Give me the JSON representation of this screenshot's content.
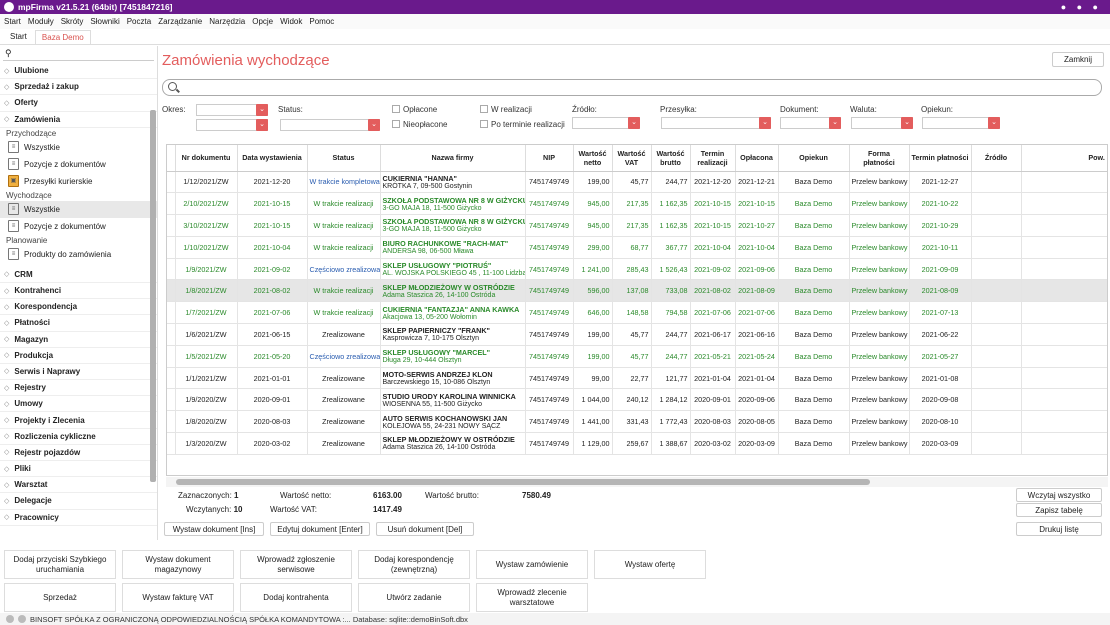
{
  "window": {
    "title": "mpFirma v21.5.21 (64bit) [7451847216]"
  },
  "menu": [
    "Start",
    "Moduły",
    "Skróty",
    "Słowniki",
    "Poczta",
    "Zarządzanie",
    "Narzędzia",
    "Opcje",
    "Widok",
    "Pomoc"
  ],
  "tabs": [
    {
      "label": "Start"
    },
    {
      "label": "Baza Demo"
    }
  ],
  "sidebar": {
    "search_placeholder": "",
    "groups_top": [
      "Ulubione",
      "Sprzedaż i zakup",
      "Oferty",
      "Zamówienia"
    ],
    "zamowienia": {
      "przychodzace": {
        "label": "Przychodzące",
        "items": [
          "Wszystkie",
          "Pozycje z dokumentów",
          "Przesyłki kurierskie"
        ]
      },
      "wychodzace": {
        "label": "Wychodzące",
        "items": [
          "Wszystkie",
          "Pozycje z dokumentów"
        ]
      },
      "planowanie": {
        "label": "Planowanie",
        "items": [
          "Produkty do zamówienia"
        ]
      }
    },
    "groups_bottom": [
      "CRM",
      "Kontrahenci",
      "Korespondencja",
      "Płatności",
      "Magazyn",
      "Produkcja",
      "Serwis i Naprawy",
      "Rejestry",
      "Umowy",
      "Projekty i Zlecenia",
      "Rozliczenia cykliczne",
      "Rejestr pojazdów",
      "Pliki",
      "Warsztat",
      "Delegacje",
      "Pracownicy"
    ]
  },
  "page": {
    "title": "Zamówienia wychodzące",
    "close_label": "Zamknij",
    "search_value": ""
  },
  "filters": {
    "okres": "Okres:",
    "status": "Status:",
    "oplacone": "Opłacone",
    "nieoplacone": "Nieopłacone",
    "w_realizacji": "W realizacji",
    "po_terminie": "Po terminie realizacji",
    "zrodlo": "Źródło:",
    "przesylka": "Przesyłka:",
    "dokument": "Dokument:",
    "waluta": "Waluta:",
    "opiekun": "Opiekun:"
  },
  "table": {
    "headers": [
      "Nr dokumentu",
      "Data wystawienia",
      "Status",
      "Nazwa firmy",
      "NIP",
      "Wartość netto",
      "Wartość VAT",
      "Wartość brutto",
      "Termin realizacji",
      "Opłacona",
      "Opiekun",
      "Forma płatności",
      "Termin płatności",
      "Źródło",
      "Pow. dok"
    ],
    "rows": [
      {
        "nr": "1/12/2021/ZW",
        "data": "2021-12-20",
        "status": "W trakcie kompletowania",
        "firma": "CUKIERNIA \"HANNA\"",
        "adres": "KRÓTKA 7, 09-500 Gostynin",
        "nip": "7451749749",
        "netto": "199,00",
        "vat": "45,77",
        "brutto": "244,77",
        "termin": "2021-12-20",
        "oplacona": "2021-12-21",
        "opiekun": "Baza Demo",
        "forma": "Przelew bankowy",
        "tplat": "2021-12-27",
        "zrodlo": "",
        "pow": "",
        "style": "normal",
        "st": "blue"
      },
      {
        "nr": "2/10/2021/ZW",
        "data": "2021-10-15",
        "status": "W trakcie realizacji",
        "firma": "SZKOŁA PODSTAWOWA NR 8 W GIŻYCKU",
        "adres": "3-GO MAJA 18, 11-500 Giżycko",
        "nip": "7451749749",
        "netto": "945,00",
        "vat": "217,35",
        "brutto": "1 162,35",
        "termin": "2021-10-15",
        "oplacona": "2021-10-15",
        "opiekun": "Baza Demo",
        "forma": "Przelew bankowy",
        "tplat": "2021-10-22",
        "zrodlo": "",
        "pow": "",
        "style": "green",
        "st": "green"
      },
      {
        "nr": "3/10/2021/ZW",
        "data": "2021-10-15",
        "status": "W trakcie realizacji",
        "firma": "SZKOŁA PODSTAWOWA NR 8 W GIŻYCKU",
        "adres": "3-GO MAJA 18, 11-500 Giżycko",
        "nip": "7451749749",
        "netto": "945,00",
        "vat": "217,35",
        "brutto": "1 162,35",
        "termin": "2021-10-15",
        "oplacona": "2021-10-27",
        "opiekun": "Baza Demo",
        "forma": "Przelew bankowy",
        "tplat": "2021-10-29",
        "zrodlo": "",
        "pow": "",
        "style": "green",
        "st": "green"
      },
      {
        "nr": "1/10/2021/ZW",
        "data": "2021-10-04",
        "status": "W trakcie realizacji",
        "firma": "BIURO RACHUNKOWE \"RACH-MAT\"",
        "adres": "ANDERSA 98, 06-500 Mława",
        "nip": "7451749749",
        "netto": "299,00",
        "vat": "68,77",
        "brutto": "367,77",
        "termin": "2021-10-04",
        "oplacona": "2021-10-04",
        "opiekun": "Baza Demo",
        "forma": "Przelew bankowy",
        "tplat": "2021-10-11",
        "zrodlo": "",
        "pow": "",
        "style": "green",
        "st": "green"
      },
      {
        "nr": "1/9/2021/ZW",
        "data": "2021-09-02",
        "status": "Częściowo zrealizowane",
        "firma": "SKLEP USŁUGOWY \"PIOTRUŚ\"",
        "adres": "AL. WOJSKA POLSKIEGO 45 , 11-100 Lidzbark W",
        "nip": "7451749749",
        "netto": "1 241,00",
        "vat": "285,43",
        "brutto": "1 526,43",
        "termin": "2021-09-02",
        "oplacona": "2021-09-06",
        "opiekun": "Baza Demo",
        "forma": "Przelew bankowy",
        "tplat": "2021-09-09",
        "zrodlo": "",
        "pow": "",
        "style": "green",
        "st": "blue"
      },
      {
        "nr": "1/8/2021/ZW",
        "data": "2021-08-02",
        "status": "W trakcie realizacji",
        "firma": "SKLEP MŁODZIEŻOWY W OSTRÓDZIE",
        "adres": "Adama Staszica 26, 14-100 Ostróda",
        "nip": "7451749749",
        "netto": "596,00",
        "vat": "137,08",
        "brutto": "733,08",
        "termin": "2021-08-02",
        "oplacona": "2021-08-09",
        "opiekun": "Baza Demo",
        "forma": "Przelew bankowy",
        "tplat": "2021-08-09",
        "zrodlo": "",
        "pow": "",
        "style": "green sel",
        "st": "green"
      },
      {
        "nr": "1/7/2021/ZW",
        "data": "2021-07-06",
        "status": "W trakcie realizacji",
        "firma": "CUKIERNIA \"FANTAZJA\" ANNA KAWKA",
        "adres": "Akacjowa 13, 05-200 Wołomin",
        "nip": "7451749749",
        "netto": "646,00",
        "vat": "148,58",
        "brutto": "794,58",
        "termin": "2021-07-06",
        "oplacona": "2021-07-06",
        "opiekun": "Baza Demo",
        "forma": "Przelew bankowy",
        "tplat": "2021-07-13",
        "zrodlo": "",
        "pow": "",
        "style": "green",
        "st": "green"
      },
      {
        "nr": "1/6/2021/ZW",
        "data": "2021-06-15",
        "status": "Zrealizowane",
        "firma": "SKLEP PAPIERNICZY \"FRANK\"",
        "adres": "Kasprowicza 7, 10-175 Olsztyn",
        "nip": "7451749749",
        "netto": "199,00",
        "vat": "45,77",
        "brutto": "244,77",
        "termin": "2021-06-17",
        "oplacona": "2021-06-16",
        "opiekun": "Baza Demo",
        "forma": "Przelew bankowy",
        "tplat": "2021-06-22",
        "zrodlo": "",
        "pow": "",
        "style": "normal",
        "st": "normal"
      },
      {
        "nr": "1/5/2021/ZW",
        "data": "2021-05-20",
        "status": "Częściowo zrealizowane",
        "firma": "SKLEP USŁUGOWY \"MARCEL\"",
        "adres": "Długa 29, 10-444 Olsztyn",
        "nip": "7451749749",
        "netto": "199,00",
        "vat": "45,77",
        "brutto": "244,77",
        "termin": "2021-05-21",
        "oplacona": "2021-05-24",
        "opiekun": "Baza Demo",
        "forma": "Przelew bankowy",
        "tplat": "2021-05-27",
        "zrodlo": "",
        "pow": "",
        "style": "green",
        "st": "blue"
      },
      {
        "nr": "1/1/2021/ZW",
        "data": "2021-01-01",
        "status": "Zrealizowane",
        "firma": "MOTO-SERWIS ANDRZEJ KLON",
        "adres": "Barczewskiego 15, 10-086 Olsztyn",
        "nip": "7451749749",
        "netto": "99,00",
        "vat": "22,77",
        "brutto": "121,77",
        "termin": "2021-01-04",
        "oplacona": "2021-01-04",
        "opiekun": "Baza Demo",
        "forma": "Przelew bankowy",
        "tplat": "2021-01-08",
        "zrodlo": "",
        "pow": "",
        "style": "normal",
        "st": "normal"
      },
      {
        "nr": "1/9/2020/ZW",
        "data": "2020-09-01",
        "status": "Zrealizowane",
        "firma": "STUDIO URODY KAROLINA WINNICKA",
        "adres": "WIOSENNA 55, 11-500 Giżycko",
        "nip": "7451749749",
        "netto": "1 044,00",
        "vat": "240,12",
        "brutto": "1 284,12",
        "termin": "2020-09-01",
        "oplacona": "2020-09-06",
        "opiekun": "Baza Demo",
        "forma": "Przelew bankowy",
        "tplat": "2020-09-08",
        "zrodlo": "",
        "pow": "",
        "style": "normal",
        "st": "normal"
      },
      {
        "nr": "1/8/2020/ZW",
        "data": "2020-08-03",
        "status": "Zrealizowane",
        "firma": "AUTO SERWIS KOCHANOWSKI JAN",
        "adres": "KOLEJOWA 55, 24-231 NOWY SĄCZ",
        "nip": "7451749749",
        "netto": "1 441,00",
        "vat": "331,43",
        "brutto": "1 772,43",
        "termin": "2020-08-03",
        "oplacona": "2020-08-05",
        "opiekun": "Baza Demo",
        "forma": "Przelew bankowy",
        "tplat": "2020-08-10",
        "zrodlo": "",
        "pow": "",
        "style": "normal",
        "st": "normal"
      },
      {
        "nr": "1/3/2020/ZW",
        "data": "2020-03-02",
        "status": "Zrealizowane",
        "firma": "SKLEP MŁODZIEŻOWY W OSTRÓDZIE",
        "adres": "Adama Staszica 26, 14-100 Ostróda",
        "nip": "7451749749",
        "netto": "1 129,00",
        "vat": "259,67",
        "brutto": "1 388,67",
        "termin": "2020-03-02",
        "oplacona": "2020-03-09",
        "opiekun": "Baza Demo",
        "forma": "Przelew bankowy",
        "tplat": "2020-03-09",
        "zrodlo": "",
        "pow": "",
        "style": "normal",
        "st": "normal"
      }
    ]
  },
  "summary": {
    "zaznaczonych_label": "Zaznaczonych:",
    "zaznaczonych": "1",
    "wczytanych_label": "Wczytanych:",
    "wczytanych": "10",
    "netto_label": "Wartość netto:",
    "netto": "6163.00",
    "vat_label": "Wartość VAT:",
    "vat": "1417.49",
    "brutto_label": "Wartość brutto:",
    "brutto": "7580.49"
  },
  "actions": {
    "wczytaj": "Wczytaj wszystko",
    "zapisz": "Zapisz tabelę",
    "drukuj": "Drukuj listę",
    "wystaw": "Wystaw dokument [Ins]",
    "edytuj": "Edytuj dokument [Enter]",
    "usun": "Usuń dokument [Del]"
  },
  "bottom_buttons": [
    [
      "Dodaj przyciski Szybkiego uruchamiania",
      "Wystaw dokument magazynowy",
      "Wprowadź zgłoszenie serwisowe",
      "Dodaj korespondencję (zewnętrzną)",
      "Wystaw zamówienie",
      "Wystaw ofertę"
    ],
    [
      "Sprzedaż",
      "Wystaw fakturę VAT",
      "Dodaj kontrahenta",
      "Utwórz zadanie",
      "Wprowadź zlecenie warsztatowe"
    ]
  ],
  "statusbar": {
    "text": "BINSOFT SPÓŁKA Z OGRANICZONĄ ODPOWIEDZIALNOŚCIĄ SPÓŁKA KOMANDYTOWA :... Database: sqlite::demoBinSoft.dbx"
  },
  "colors": {
    "accent": "#e35d5d",
    "title_bar": "#6a1a8c",
    "green": "#2a8a2a",
    "blue": "#2a5db0"
  }
}
